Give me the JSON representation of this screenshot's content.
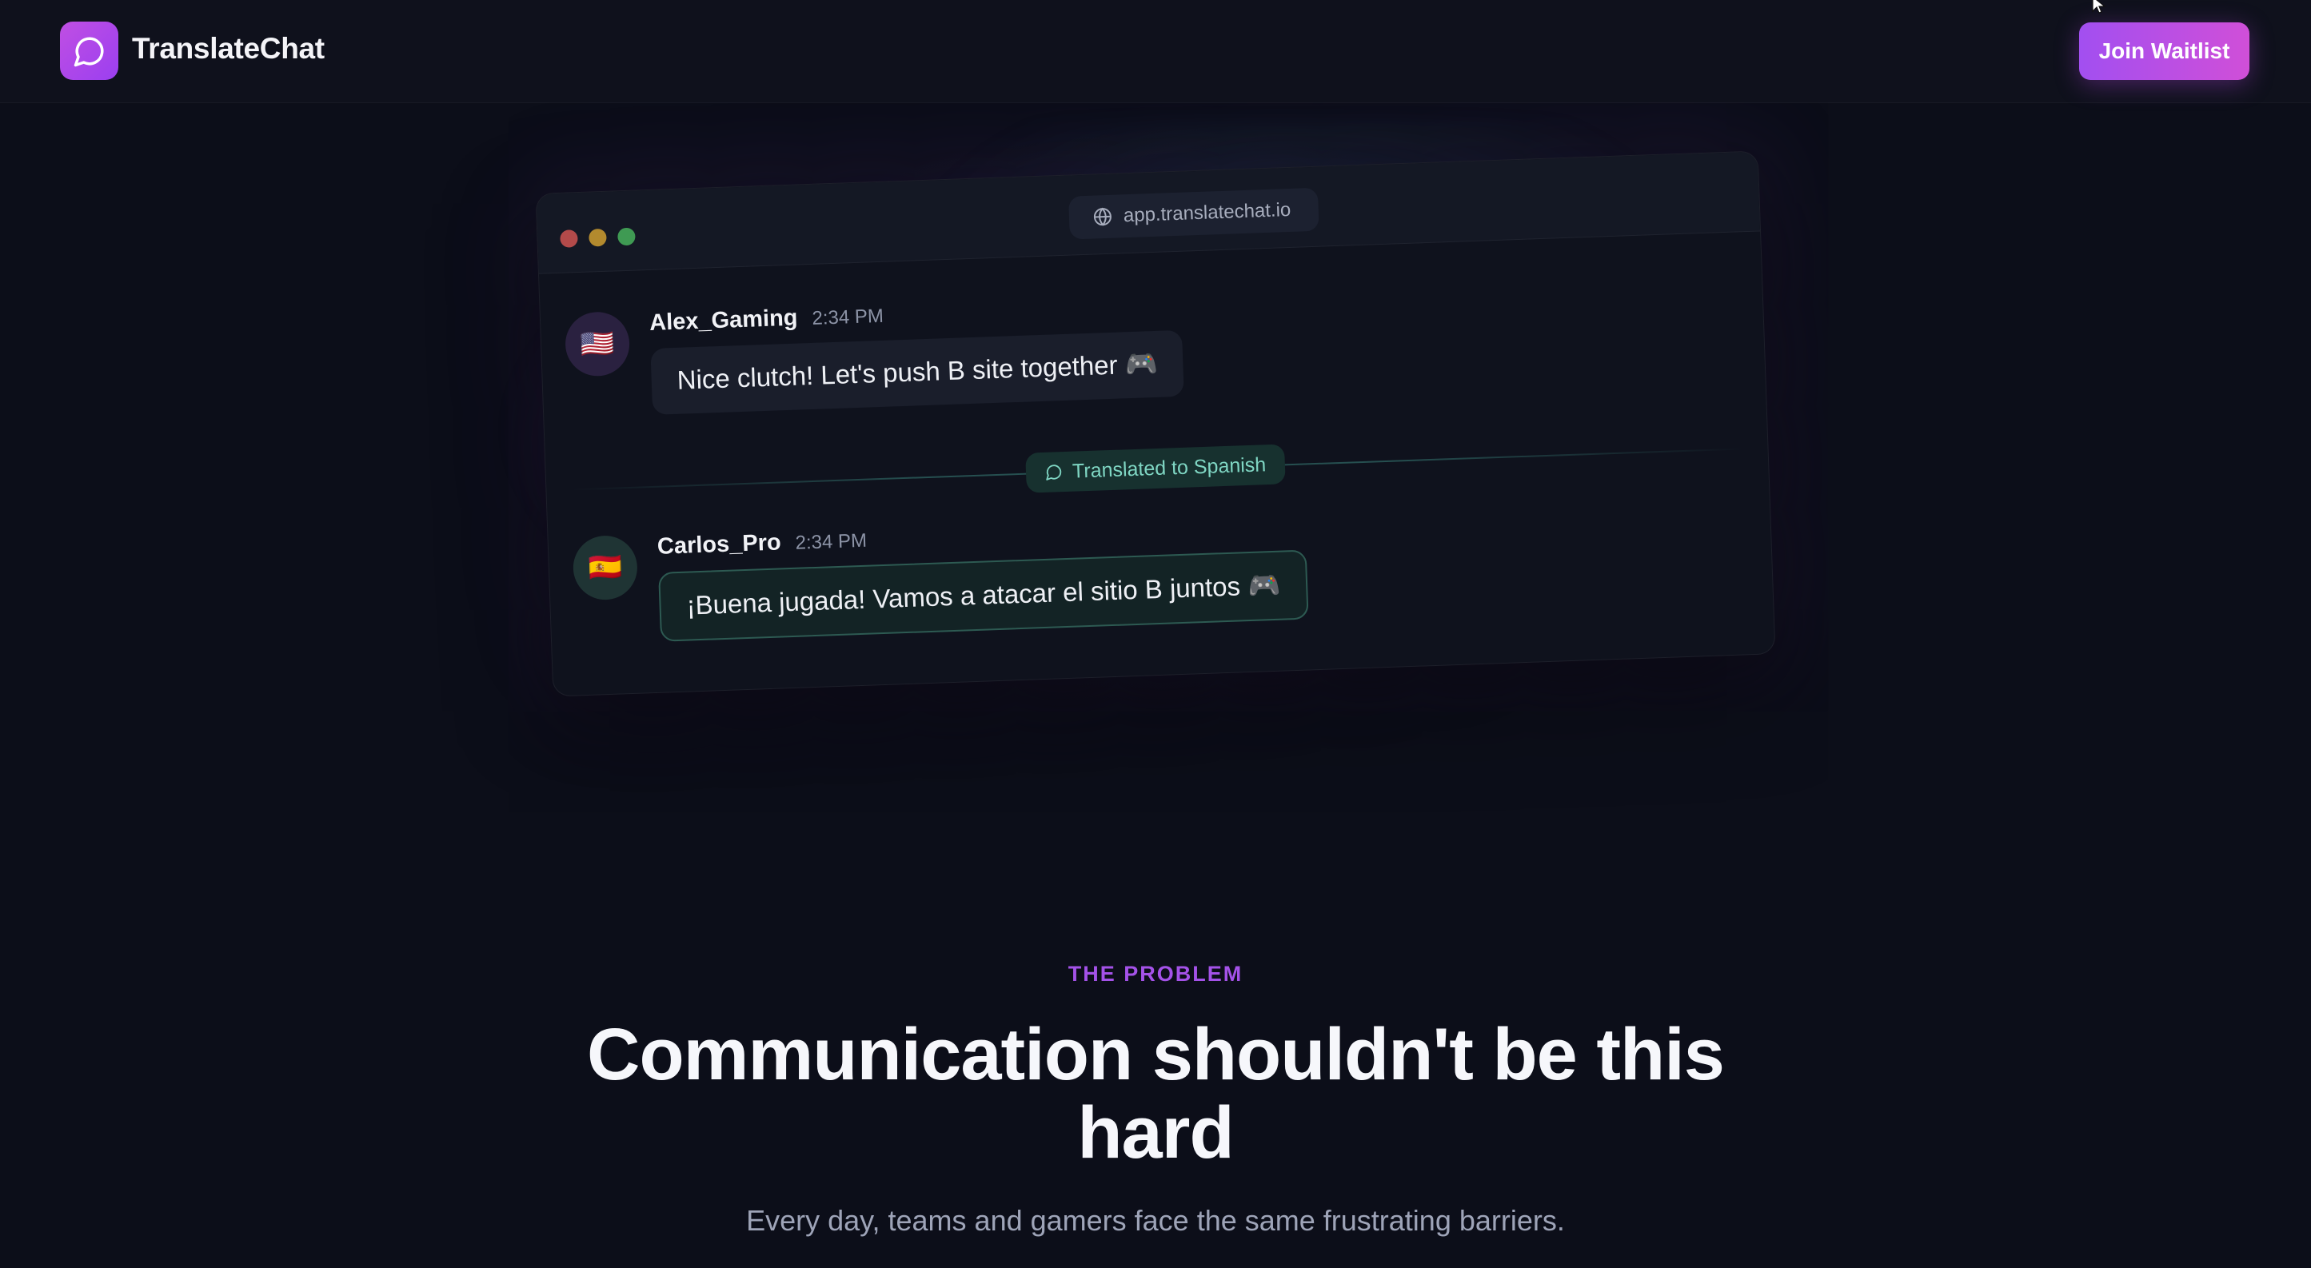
{
  "nav": {
    "brand": "TranslateChat",
    "logo_icon": "chat-bubble-icon",
    "cta_label": "Join Waitlist"
  },
  "window": {
    "url": "app.translatechat.io",
    "url_icon": "globe-icon",
    "messages": [
      {
        "user": "Alex_Gaming",
        "time": "2:34 PM",
        "flag": "🇺🇸",
        "text": "Nice clutch! Let's push B site together 🎮"
      },
      {
        "user": "Carlos_Pro",
        "time": "2:34 PM",
        "flag": "🇪🇸",
        "text": "¡Buena jugada! Vamos a atacar el sitio B juntos 🎮"
      }
    ],
    "translation_label": "Translated to Spanish"
  },
  "problem": {
    "kicker": "THE PROBLEM",
    "headline": "Communication shouldn't be this hard",
    "subtext": "Every day, teams and gamers face the same frustrating barriers."
  },
  "colors": {
    "accent": "#a452e8",
    "brand_gradient_start": "#c04fe3",
    "brand_gradient_end": "#9b3ff0",
    "translation_accent": "#7fd6c3",
    "background": "#0c0e19"
  }
}
